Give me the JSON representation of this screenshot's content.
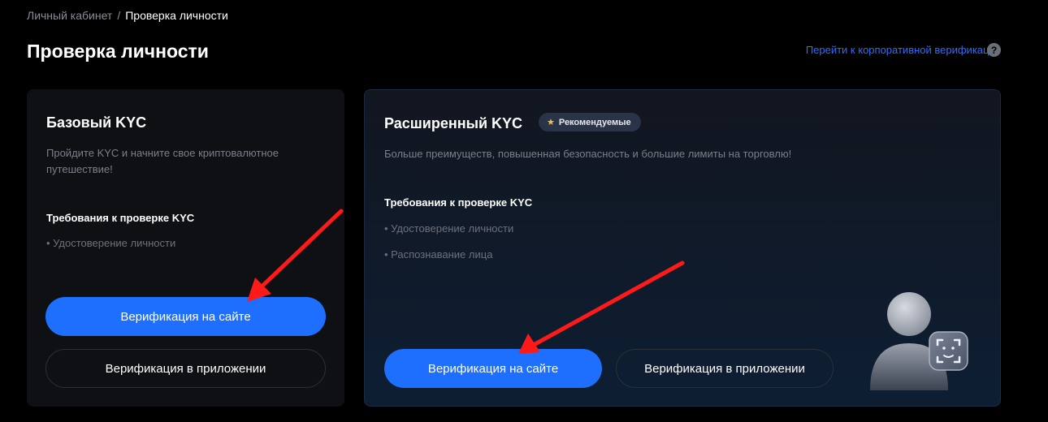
{
  "breadcrumb": {
    "parent": "Личный кабинет",
    "separator": "/",
    "current": "Проверка личности"
  },
  "page": {
    "title": "Проверка личности"
  },
  "corporate_link": {
    "label": "Перейти к корпоративной верификации",
    "help_icon": "?"
  },
  "basic_card": {
    "title": "Базовый KYC",
    "description": "Пройдите KYC и начните свое криптовалютное путешествие!",
    "requirements_title": "Требования к проверке KYC",
    "requirements": [
      "• Удостоверение личности"
    ],
    "web_button": "Верификация на сайте",
    "app_button": "Верификация в приложении"
  },
  "advanced_card": {
    "title": "Расширенный KYC",
    "badge": "Рекомендуемые",
    "description": "Больше преимуществ, повышенная безопасность и большие лимиты на торговлю!",
    "requirements_title": "Требования к проверке KYC",
    "requirements": [
      "• Удостоверение личности",
      "• Распознавание лица"
    ],
    "web_button": "Верификация на сайте",
    "app_button": "Верификация в приложении"
  },
  "colors": {
    "accent": "#1f6fff",
    "link": "#2f6cff",
    "arrow": "#ff1a1a"
  }
}
